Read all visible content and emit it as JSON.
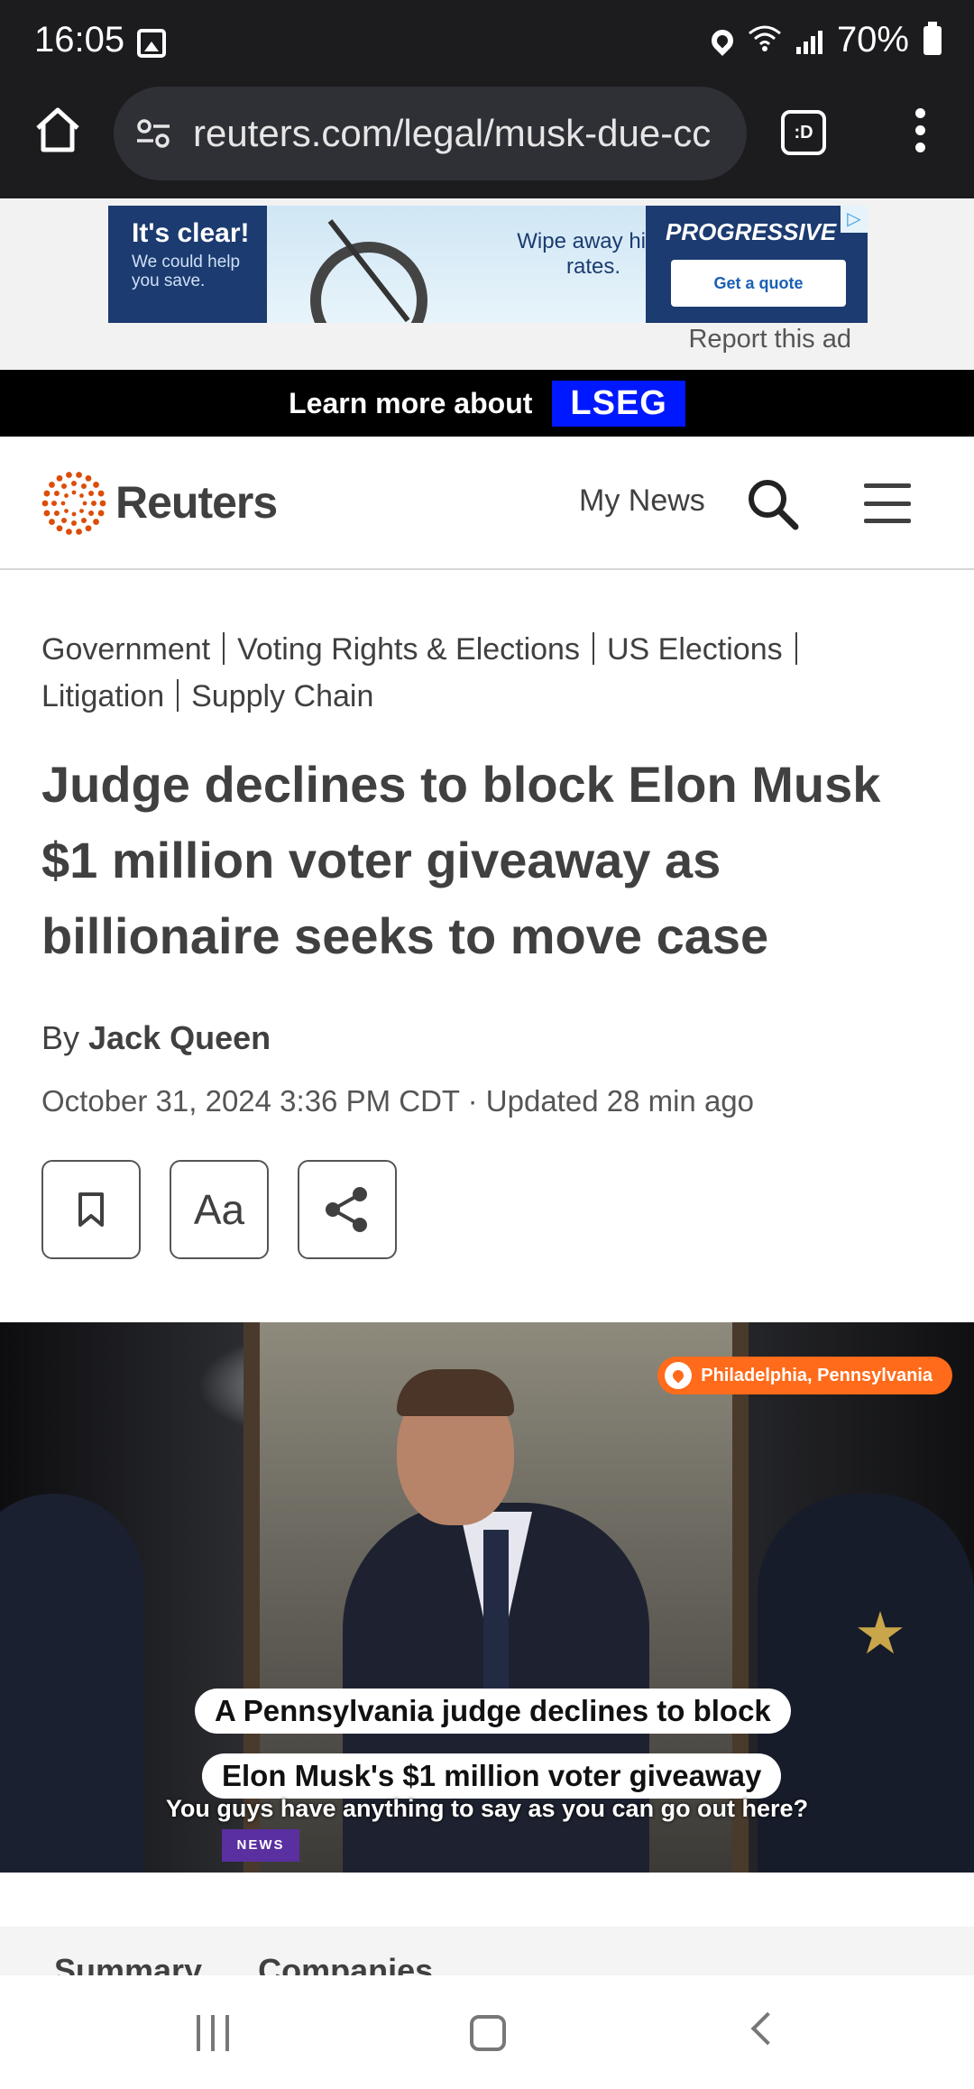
{
  "status_bar": {
    "time": "16:05",
    "battery": "70%",
    "icons": [
      "image-icon",
      "location-icon",
      "wifi-icon",
      "signal-icon",
      "battery-icon"
    ]
  },
  "browser": {
    "url": "reuters.com/legal/musk-due-cc",
    "tab_label": ":D",
    "progress_fraction": 0.035
  },
  "ad": {
    "left_title": "It's clear!",
    "left_sub": "We could help you save.",
    "middle_text": "Wipe away high rates.",
    "brand": "PROGRESSIVE",
    "cta": "Get a quote",
    "report": "Report this ad"
  },
  "promo": {
    "text": "Learn more about",
    "badge": "LSEG"
  },
  "header": {
    "logo": "Reuters",
    "my_news": "My News"
  },
  "article": {
    "topics": [
      "Government",
      "Voting Rights & Elections",
      "US Elections",
      "Litigation",
      "Supply Chain"
    ],
    "headline": "Judge declines to block Elon Musk $1 million voter giveaway as billionaire seeks to move case",
    "by": "By",
    "author": "Jack Queen",
    "dateline": "October 31, 2024 3:36 PM CDT · Updated 28 min ago",
    "font_button": "Aa"
  },
  "video": {
    "location_tag": "Philadelphia, Pennsylvania",
    "caption_line1": "A Pennsylvania judge declines to block",
    "caption_line2": "Elon Musk's $1 million voter giveaway",
    "subtitle": "You guys have anything to say as you can go out here?",
    "mic_label": "NEWS"
  },
  "tabs": {
    "summary": "Summary",
    "companies": "Companies"
  },
  "colors": {
    "reuters_orange": "#dc4d0a",
    "lseg_blue": "#0018ff",
    "location_tag": "#ff6b1a"
  }
}
